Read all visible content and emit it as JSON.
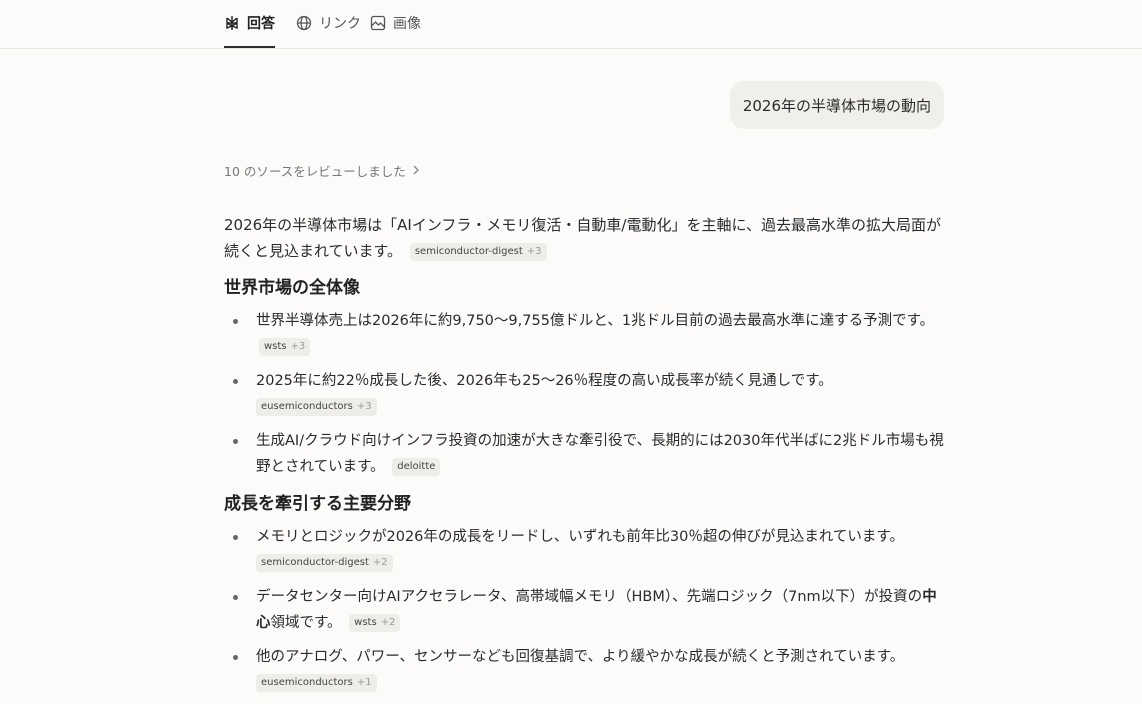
{
  "tabs": [
    {
      "label": "回答",
      "icon": "perplexity-logo-icon"
    },
    {
      "label": "リンク",
      "icon": "globe-icon"
    },
    {
      "label": "画像",
      "icon": "image-icon"
    }
  ],
  "query": "2026年の半導体市場の動向",
  "sources_label": "10 のソースをレビューしました",
  "intro": {
    "text": "2026年の半導体市場は「AIインフラ・メモリ復活・自動車/電動化」を主軸に、過去最高水準の拡大局面が続くと見込まれています。",
    "chip": {
      "name": "semiconductor-digest",
      "count": "+3"
    }
  },
  "sections": [
    {
      "title": "世界市場の全体像",
      "items": [
        {
          "text": "世界半導体売上は2026年に約9,750～9,755億ドルと、1兆ドル目前の過去最高水準に達する予測です。",
          "chip": {
            "name": "wsts",
            "count": "+3"
          }
        },
        {
          "text": "2025年に約22％成長した後、2026年も25～26％程度の高い成長率が続く見通しです。",
          "chip": {
            "name": "eusemiconductors",
            "count": "+3"
          }
        },
        {
          "text": "生成AI/クラウド向けインフラ投資の加速が大きな牽引役で、長期的には2030年代半ばに2兆ドル市場も視野とされています。",
          "chip": {
            "name": "deloitte",
            "count": ""
          }
        }
      ]
    },
    {
      "title": "成長を牽引する主要分野",
      "items": [
        {
          "text": "メモリとロジックが2026年の成長をリードし、いずれも前年比30％超の伸びが見込まれています。",
          "chip": {
            "name": "semiconductor-digest",
            "count": "+2"
          }
        },
        {
          "text_before": "データセンター向けAIアクセラレータ、高帯域幅メモリ（HBM）、先端ロジック（7nm以下）が投資の",
          "text_bold": "中心",
          "text_after": "領域です。",
          "chip": {
            "name": "wsts",
            "count": "+2"
          }
        },
        {
          "text": "他のアナログ、パワー、センサーなども回復基調で、より緩やかな成長が続くと予測されています。",
          "chip": {
            "name": "eusemiconductors",
            "count": "+1"
          }
        }
      ]
    }
  ]
}
